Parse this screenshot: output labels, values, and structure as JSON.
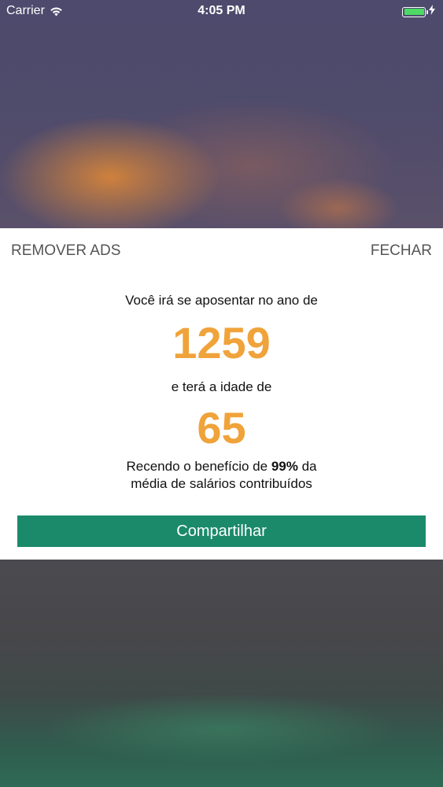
{
  "status_bar": {
    "carrier": "Carrier",
    "time": "4:05 PM",
    "battery_color": "#4cd964"
  },
  "modal": {
    "remove_ads_label": "REMOVER ADS",
    "close_label": "FECHAR",
    "retire_year_prefix": "Você irá se aposentar no ano de",
    "retire_year": "1259",
    "age_prefix": "e terá a idade de",
    "age": "65",
    "benefit_text_before": "Recendo o benefício de",
    "benefit_percent": "99%",
    "benefit_text_after": "da",
    "benefit_text_line2": "média de salários contribuídos",
    "share_label": "Compartilhar"
  },
  "colors": {
    "accent_number": "#f0a33a",
    "share_button": "#1b8a6b"
  }
}
